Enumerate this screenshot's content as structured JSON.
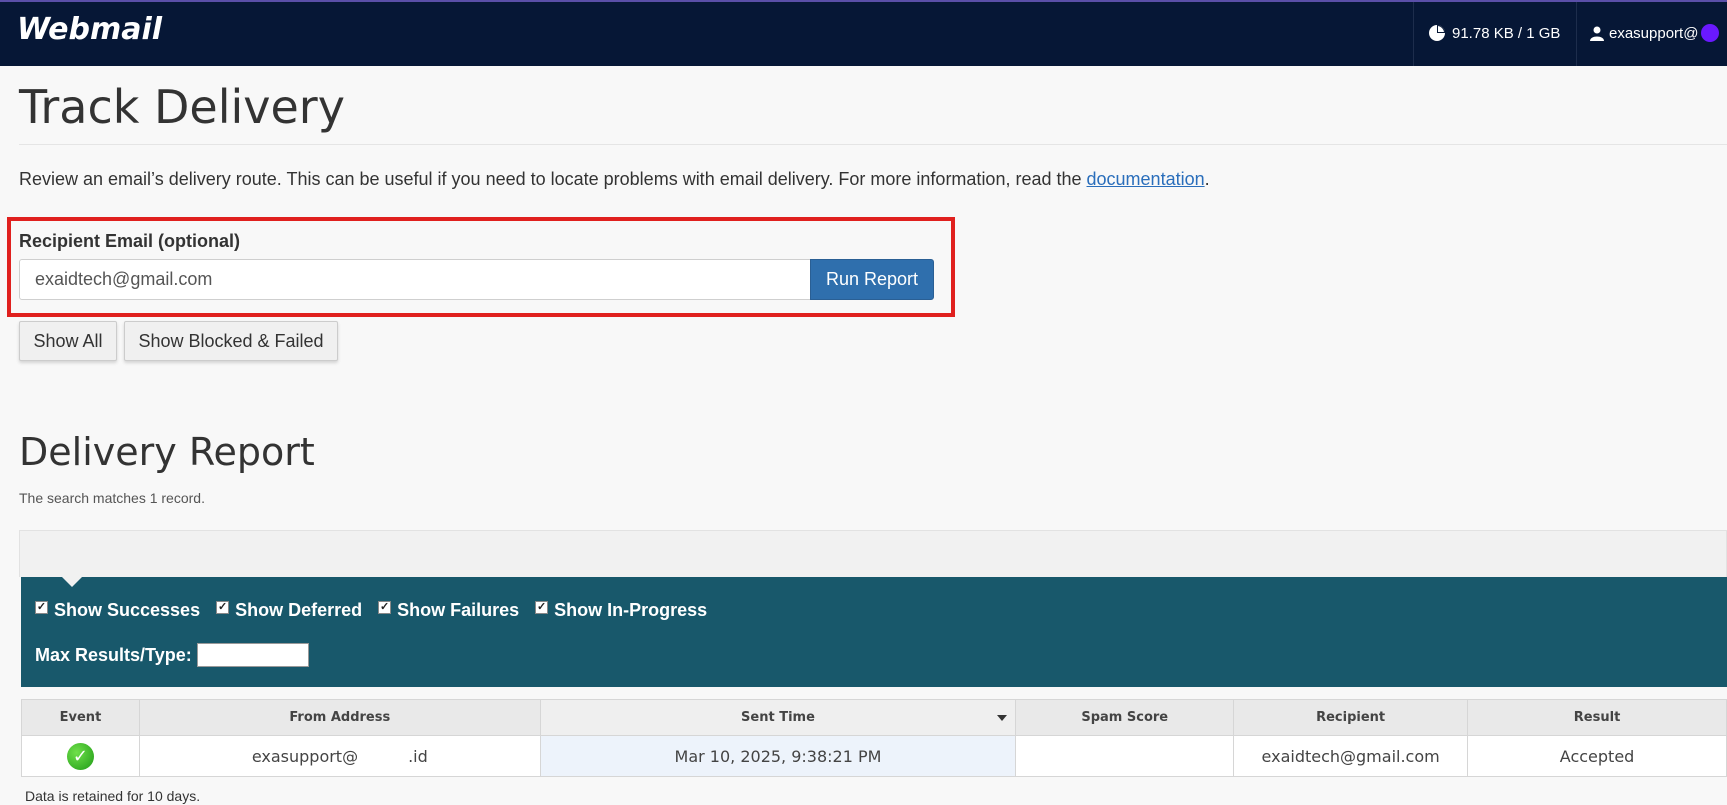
{
  "header": {
    "logo": "Webmail",
    "quota": "91.78 KB / 1 GB",
    "user": "exasupport@"
  },
  "page": {
    "title": "Track Delivery",
    "intro_text": "Review an email’s delivery route. This can be useful if you need to locate problems with email delivery. For more information, read the ",
    "intro_link": "documentation",
    "intro_end": "."
  },
  "form": {
    "label": "Recipient Email (optional)",
    "email_value": "exaidtech@gmail.com",
    "run_button": "Run Report",
    "show_all": "Show All",
    "show_blocked": "Show Blocked & Failed"
  },
  "report": {
    "title": "Delivery Report",
    "matches": "The search matches 1 record.",
    "filters": [
      {
        "label": "Show Successes",
        "checked": true
      },
      {
        "label": "Show Deferred",
        "checked": true
      },
      {
        "label": "Show Failures",
        "checked": true
      },
      {
        "label": "Show In-Progress",
        "checked": true
      }
    ],
    "max_results_label": "Max Results/Type:",
    "columns": [
      "Event",
      "From Address",
      "Sent Time",
      "Spam Score",
      "Recipient",
      "Result"
    ],
    "rows": [
      {
        "event": "success",
        "from_prefix": "exasupport@",
        "from_suffix": ".id",
        "sent_time": "Mar 10, 2025, 9:38:21 PM",
        "spam_score": "",
        "recipient": "exaidtech@gmail.com",
        "result": "Accepted"
      }
    ],
    "retention_note": "Data is retained for 10 days."
  },
  "colors": {
    "topbar": "#061736",
    "accent_button": "#2f6fad",
    "filter_panel": "#18586b",
    "highlight_box": "#e0201e"
  }
}
